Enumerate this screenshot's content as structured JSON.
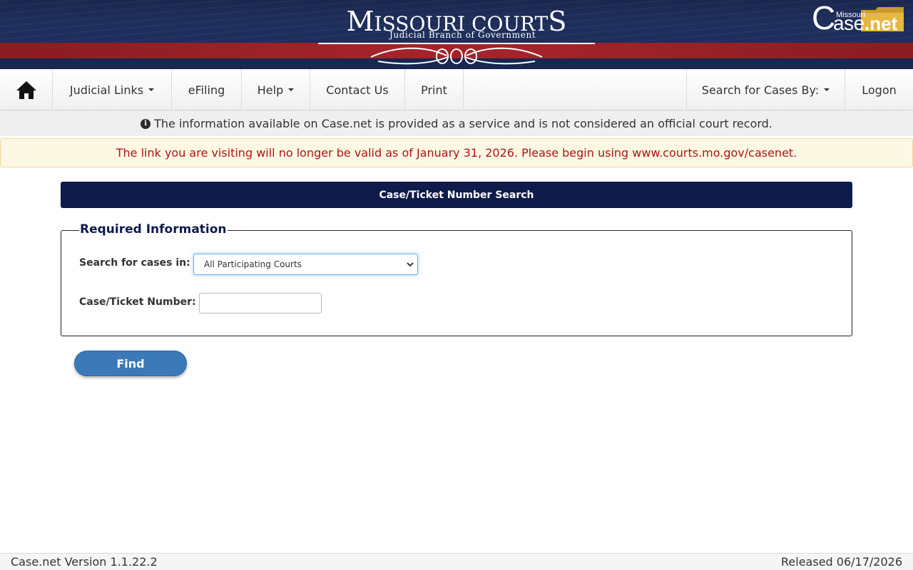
{
  "banner": {
    "title_big_m": "M",
    "title_rest": "ISSOURI COURT",
    "title_big_s": "S",
    "subtitle": "Judicial Branch of Government",
    "casenet_logo": {
      "missouri": "Missouri",
      "case_c": "C",
      "case_ase": "ase",
      "net": ".net"
    }
  },
  "nav": {
    "home_icon": "home-icon",
    "items": [
      {
        "label": "Judicial Links",
        "dropdown": true
      },
      {
        "label": "eFiling",
        "dropdown": false
      },
      {
        "label": "Help",
        "dropdown": true
      },
      {
        "label": "Contact Us",
        "dropdown": false
      },
      {
        "label": "Print",
        "dropdown": false
      }
    ],
    "search_by": "Search for Cases By:",
    "logon": "Logon"
  },
  "info": {
    "icon": "info-icon",
    "text": "The information available on Case.net is provided as a service and is not considered an official court record."
  },
  "warning": {
    "text": "The link you are visiting will no longer be valid as of January 31, 2026. Please begin using www.courts.mo.gov/casenet."
  },
  "panel": {
    "heading": "Case/Ticket Number Search"
  },
  "form": {
    "legend": "Required Information",
    "court_label": "Search for cases in:",
    "court_selected": "All Participating Courts",
    "case_label": "Case/Ticket Number:",
    "case_value": "",
    "find_button": "Find"
  },
  "footer": {
    "version": "Case.net Version 1.1.22.2",
    "released": "Released 06/17/2026"
  },
  "colors": {
    "banner_navy": "#1a2850",
    "banner_red": "#a3232a",
    "heading_navy": "#0e1b4b",
    "warning_text": "#b01216",
    "warning_bg": "#fcf8e3",
    "find_button": "#3c79b8"
  }
}
